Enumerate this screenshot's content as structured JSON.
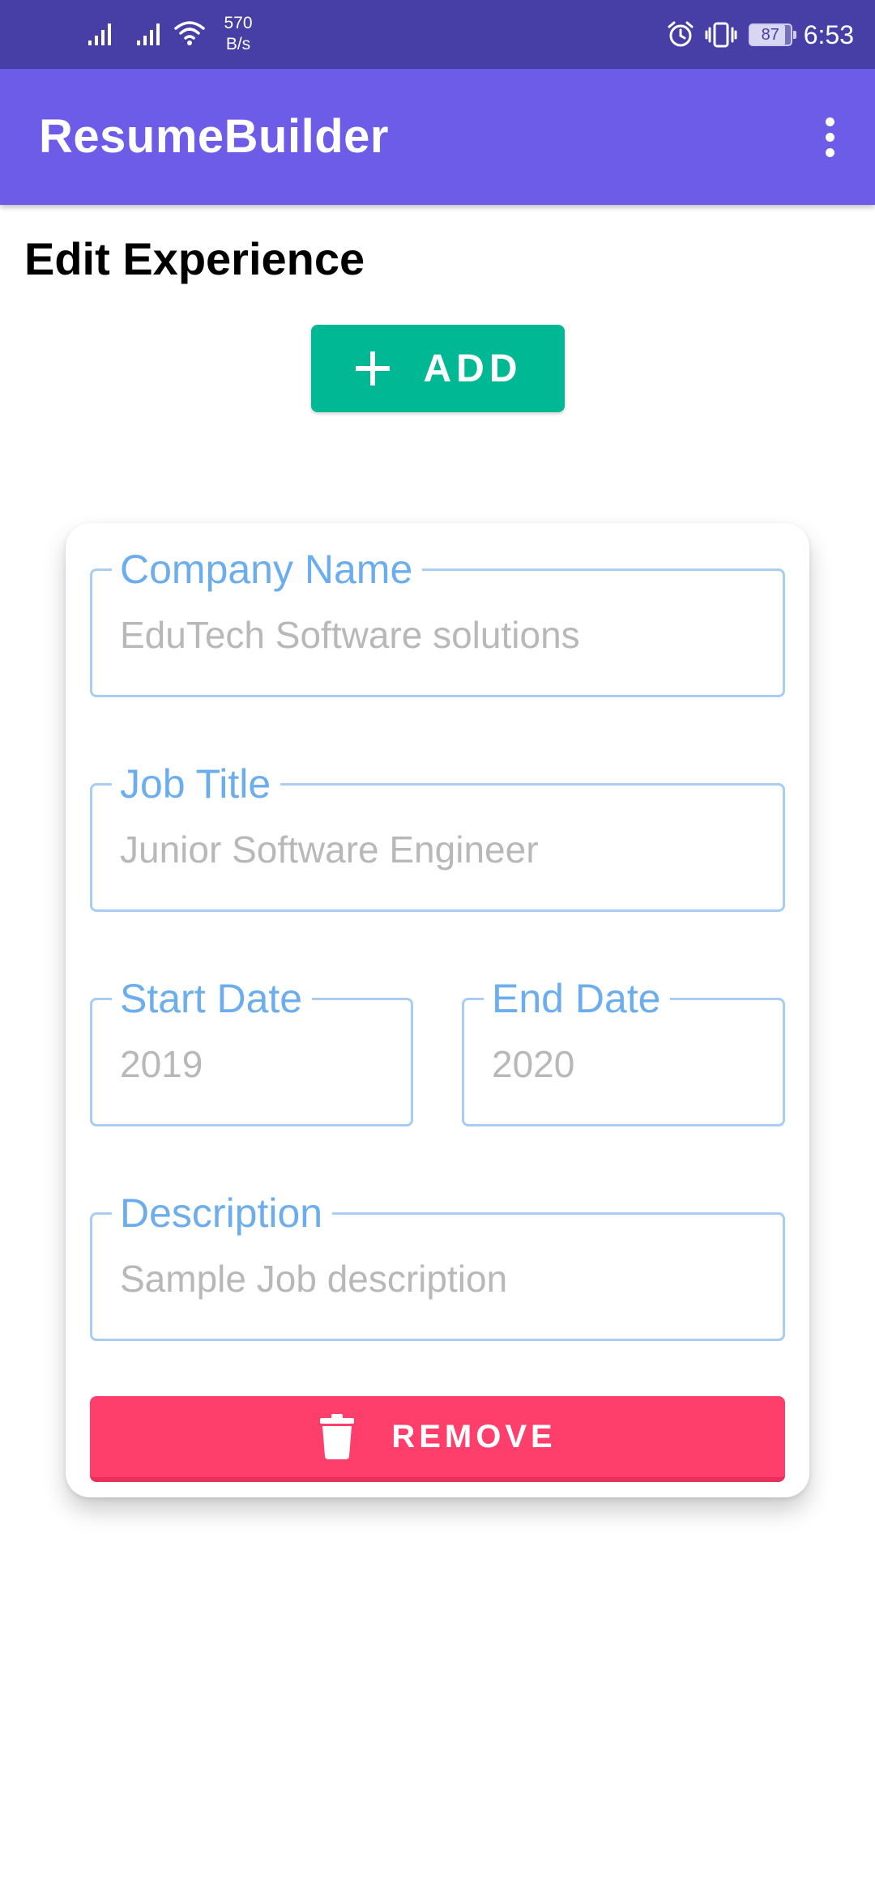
{
  "status_bar": {
    "net_speed_value": "570",
    "net_speed_unit": "B/s",
    "battery": "87",
    "battery_fraction": 0.87,
    "time": "6:53",
    "icons": [
      "signal-1-icon",
      "signal-2-icon",
      "wifi-icon",
      "alarm-icon",
      "vibrate-icon",
      "battery-icon"
    ]
  },
  "app_bar": {
    "title": "ResumeBuilder",
    "menu_icon": "overflow-menu-icon"
  },
  "page": {
    "title": "Edit Experience",
    "add_button_label": "ADD",
    "add_icon": "plus-icon"
  },
  "experience": {
    "company_name": {
      "label": "Company Name",
      "value": "EduTech Software solutions"
    },
    "job_title": {
      "label": "Job Title",
      "value": "Junior Software Engineer"
    },
    "start_date": {
      "label": "Start Date",
      "value": "2019"
    },
    "end_date": {
      "label": "End Date",
      "value": "2020"
    },
    "description": {
      "label": "Description",
      "value": "Sample Job description"
    },
    "remove_button_label": "REMOVE",
    "remove_icon": "trash-icon"
  },
  "colors": {
    "status_bar": "#483fa6",
    "app_bar": "#6c5ce7",
    "add_button": "#00b894",
    "remove_button": "#ff3f6b",
    "field_border": "#a8cdf0",
    "field_label": "#6cadee",
    "field_value": "#b8b8b8"
  }
}
